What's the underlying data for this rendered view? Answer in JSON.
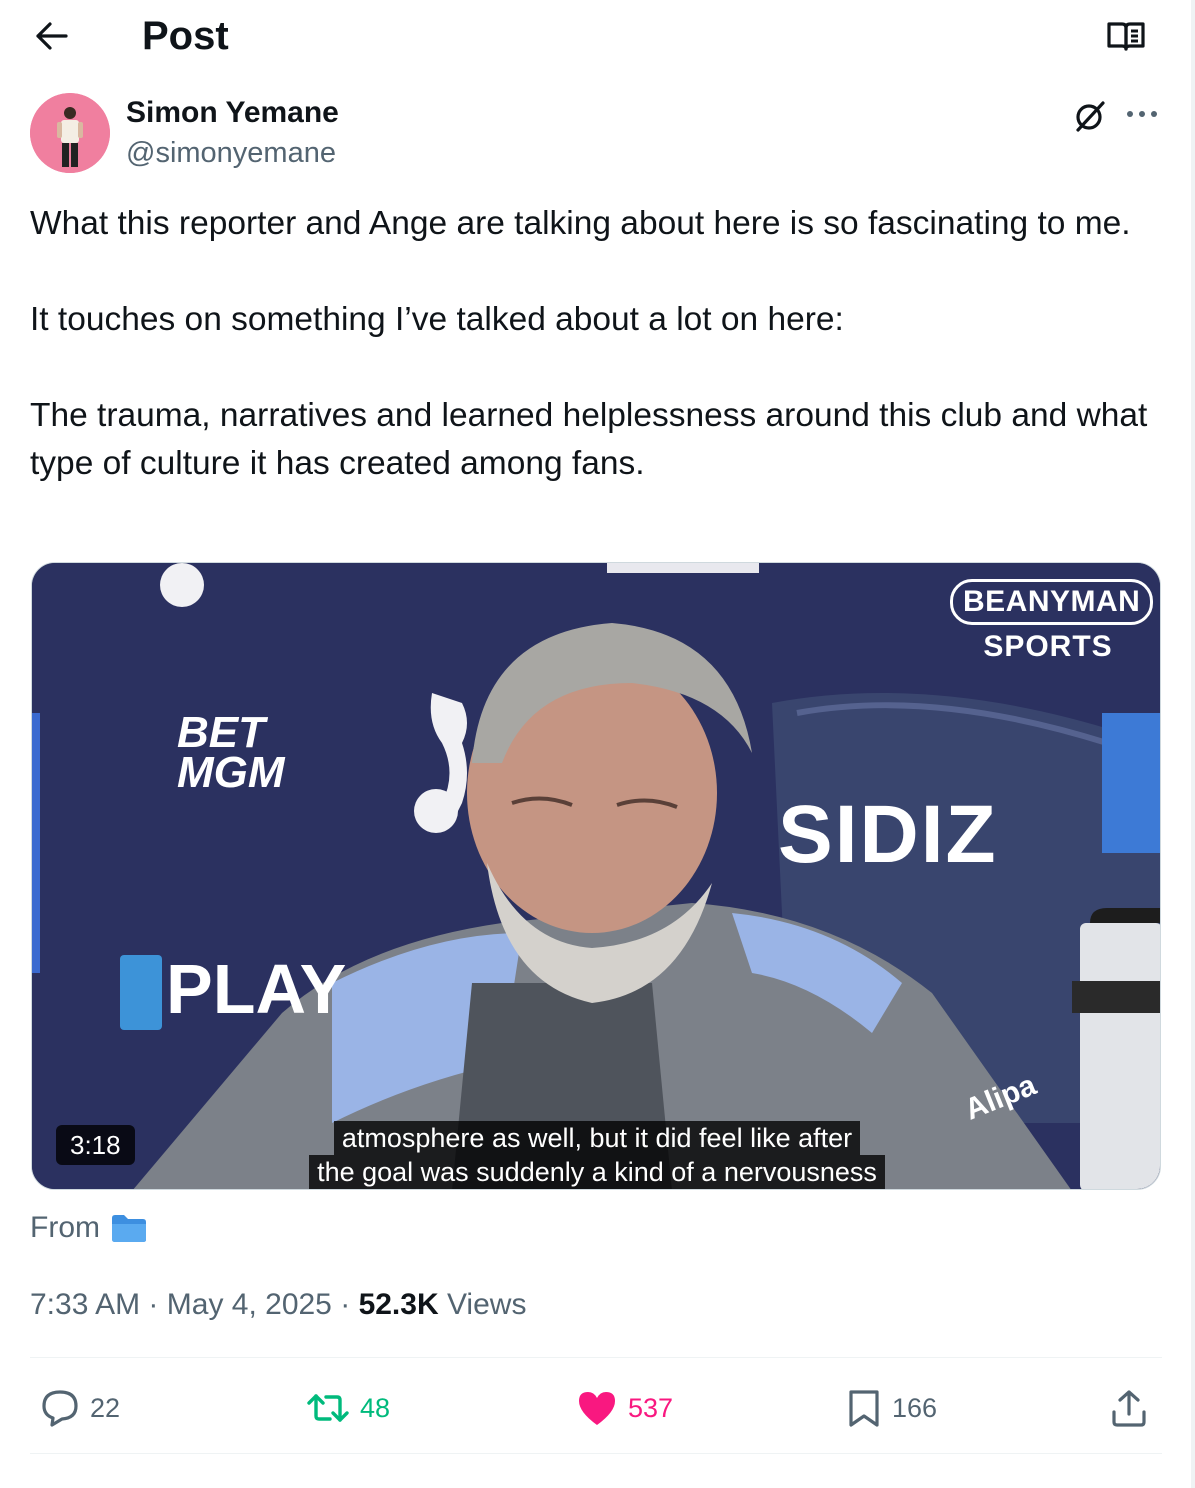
{
  "header": {
    "title": "Post"
  },
  "author": {
    "display_name": "Simon Yemane",
    "handle": "@simonyemane"
  },
  "tweet": {
    "paragraphs": [
      "What this reporter and Ange are talking about here is so fascinating to me.",
      "It touches on something I’ve talked about a lot on here:",
      "The trauma, narratives and learned helplessness around this club and what type of culture it has created among fans."
    ]
  },
  "video": {
    "duration": "3:18",
    "caption_line_1": "atmosphere as well, but it did feel like after",
    "caption_line_2": "the goal was suddenly a kind of a nervousness",
    "watermark_line_1": "BEANYMAN",
    "watermark_line_2": "SPORTS",
    "sponsor_1a": "BET",
    "sponsor_1b": "MGM",
    "sponsor_2": "PLAY",
    "sponsor_3": "SIDIZ",
    "sponsor_4": "Alipa"
  },
  "source": {
    "label": "From",
    "icon": "folder-icon"
  },
  "meta": {
    "time": "7:33 AM",
    "separator": "·",
    "date": "May 4, 2025",
    "views_count": "52.3K",
    "views_label": "Views"
  },
  "actions": {
    "replies": "22",
    "reposts": "48",
    "likes": "537",
    "bookmarks": "166"
  },
  "colors": {
    "accent_like": "#f91880",
    "accent_repost": "#00ba7c",
    "secondary_text": "#536471",
    "primary_text": "#0f1419",
    "folder_blue": "#4aa0e6"
  }
}
